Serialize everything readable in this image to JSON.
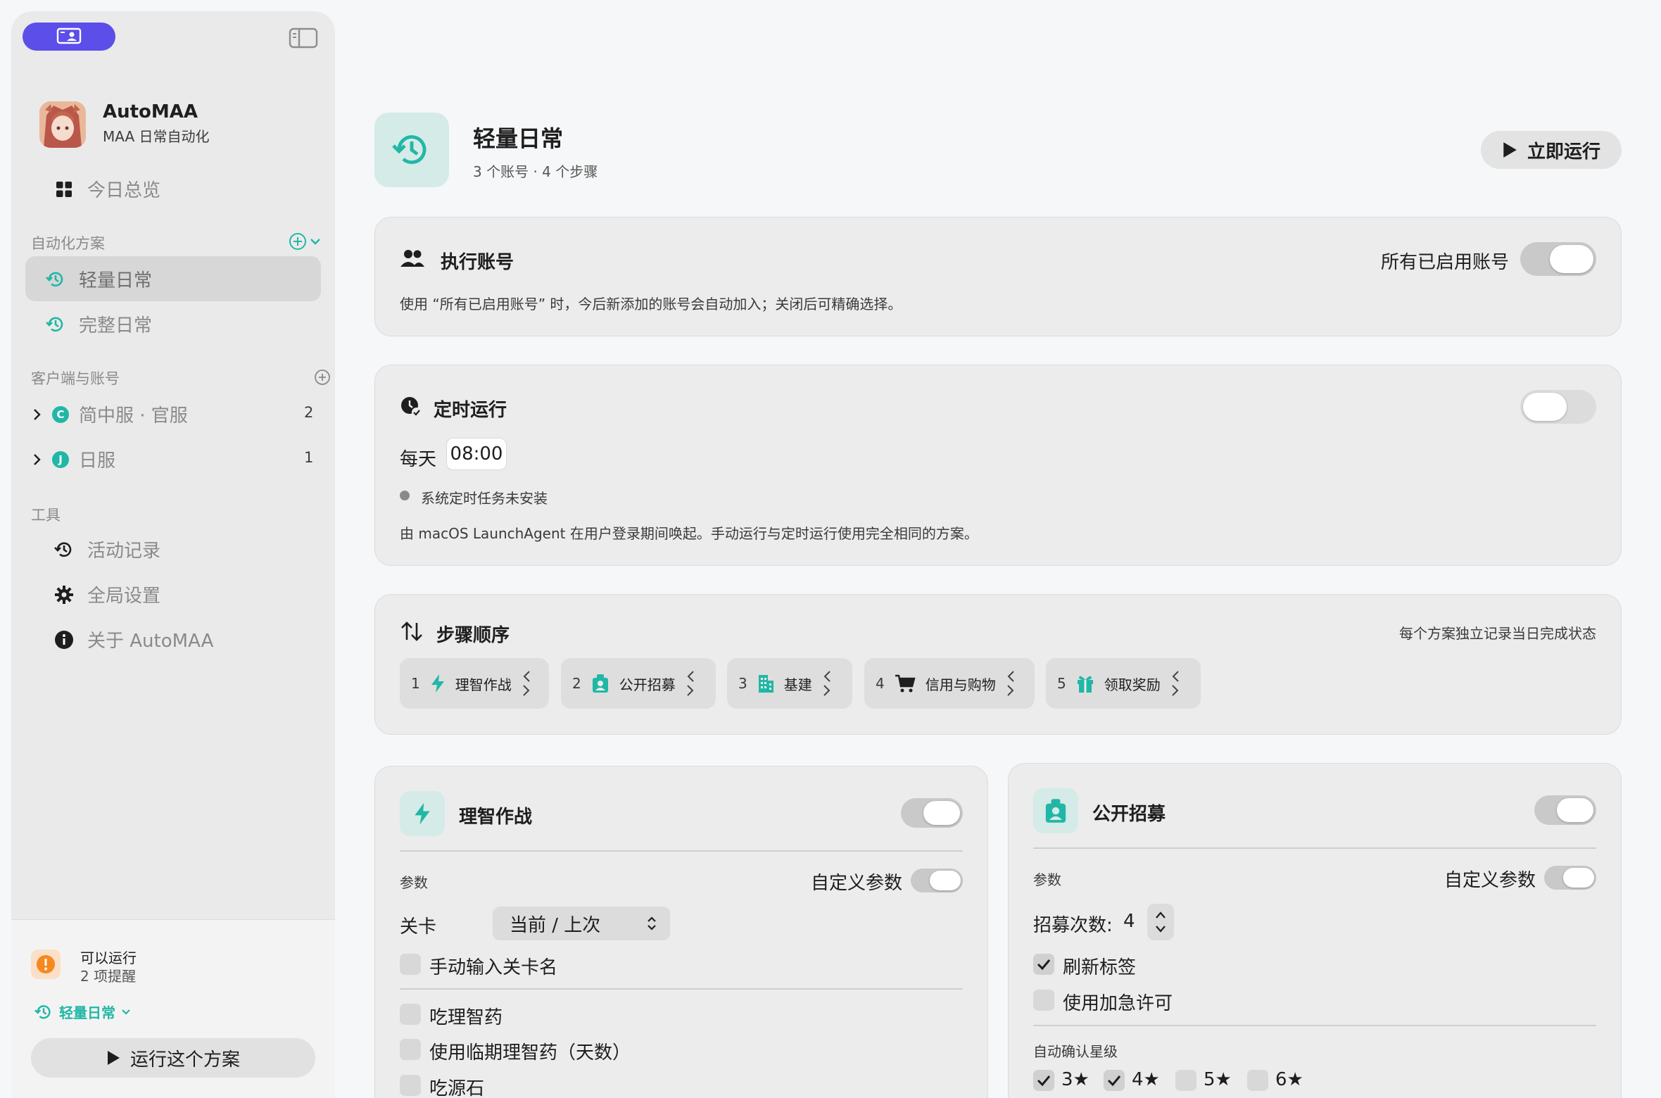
{
  "sidebar": {
    "app": {
      "name": "AutoMAA",
      "subtitle": "MAA 日常自动化"
    },
    "overview_label": "今日总览",
    "automation_section": "自动化方案",
    "plans": [
      {
        "label": "轻量日常",
        "selected": true
      },
      {
        "label": "完整日常",
        "selected": false
      }
    ],
    "clients_section": "客户端与账号",
    "clients": [
      {
        "badge": "C",
        "label": "简中服 · 官服",
        "count": "2"
      },
      {
        "badge": "J",
        "label": "日服",
        "count": "1"
      }
    ],
    "tools_section": "工具",
    "tools": [
      {
        "label": "活动记录",
        "icon": "history-icon"
      },
      {
        "label": "全局设置",
        "icon": "gear-icon"
      },
      {
        "label": "关于 AutoMAA",
        "icon": "info-icon"
      }
    ],
    "status": {
      "title": "可以运行",
      "detail": "2 项提醒"
    },
    "current_plan": "轻量日常",
    "run_button": "运行这个方案"
  },
  "header": {
    "title": "轻量日常",
    "subtitle": "3 个账号 · 4 个步骤",
    "run_now": "立即运行"
  },
  "accounts_card": {
    "title": "执行账号",
    "toggle_label": "所有已启用账号",
    "toggle_on": true,
    "note": "使用 “所有已启用账号” 时，今后新添加的账号会自动加入；关闭后可精确选择。"
  },
  "schedule_card": {
    "title": "定时运行",
    "toggle_on": false,
    "freq_label": "每天",
    "time": "08:00",
    "status": "系统定时任务未安装",
    "note": "由 macOS LaunchAgent 在用户登录期间唤起。手动运行与定时运行使用完全相同的方案。"
  },
  "steps_card": {
    "title": "步骤顺序",
    "note": "每个方案独立记录当日完成状态",
    "steps": [
      {
        "n": "1",
        "label": "理智作战",
        "icon": "bolt-icon"
      },
      {
        "n": "2",
        "label": "公开招募",
        "icon": "recruit-icon"
      },
      {
        "n": "3",
        "label": "基建",
        "icon": "building-icon"
      },
      {
        "n": "4",
        "label": "信用与购物",
        "icon": "cart-icon"
      },
      {
        "n": "5",
        "label": "领取奖励",
        "icon": "gift-icon"
      }
    ]
  },
  "combat_card": {
    "title": "理智作战",
    "enabled": true,
    "params_label": "参数",
    "custom_label": "自定义参数",
    "custom_on": true,
    "stage_label": "关卡",
    "stage_value": "当前 / 上次",
    "options": [
      {
        "label": "手动输入关卡名",
        "checked": false
      },
      {
        "label": "吃理智药",
        "checked": false
      },
      {
        "label": "使用临期理智药（天数）",
        "checked": false
      },
      {
        "label": "吃源石",
        "checked": false
      }
    ]
  },
  "recruit_card": {
    "title": "公开招募",
    "enabled": true,
    "params_label": "参数",
    "custom_label": "自定义参数",
    "custom_on": true,
    "times_label": "招募次数:",
    "times_value": "4",
    "options": [
      {
        "label": "刷新标签",
        "checked": true
      },
      {
        "label": "使用加急许可",
        "checked": false
      }
    ],
    "confirm_label": "自动确认星级",
    "stars": [
      {
        "label": "3★",
        "checked": true
      },
      {
        "label": "4★",
        "checked": true
      },
      {
        "label": "5★",
        "checked": false
      },
      {
        "label": "6★",
        "checked": false
      }
    ]
  },
  "colors": {
    "accent": "#21b7a6",
    "brand": "#5c4ee8",
    "warning": "#f5891f"
  }
}
